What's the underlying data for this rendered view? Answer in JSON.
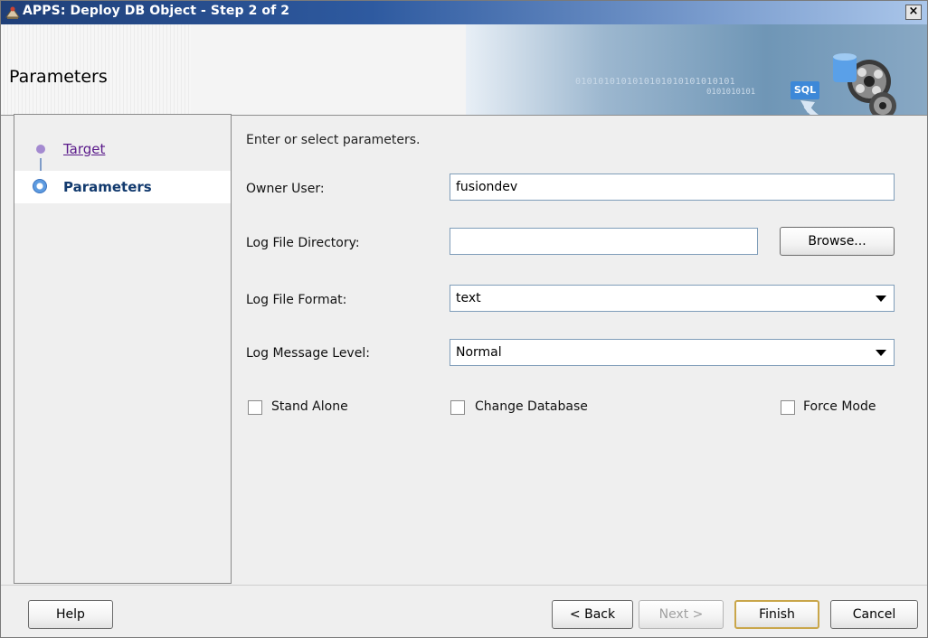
{
  "window": {
    "title": "APPS: Deploy DB Object - Step 2 of 2",
    "close_glyph": "×"
  },
  "banner": {
    "page_title": "Parameters",
    "binary_text_1": "0101010101010101010101010101",
    "binary_text_2": "0101010101",
    "sql_badge": "SQL"
  },
  "steps": [
    {
      "label": "Target",
      "state": "link"
    },
    {
      "label": "Parameters",
      "state": "current"
    }
  ],
  "form": {
    "intro": "Enter or select parameters.",
    "owner_user": {
      "label": "Owner User:",
      "value": "fusiondev"
    },
    "log_file_directory": {
      "label": "Log File Directory:",
      "value": "",
      "browse_label": "Browse..."
    },
    "log_file_format": {
      "label": "Log File Format:",
      "value": "text"
    },
    "log_message_level": {
      "label": "Log Message Level:",
      "value": "Normal"
    },
    "stand_alone": {
      "label": "Stand Alone",
      "checked": false
    },
    "change_database": {
      "label": "Change Database",
      "checked": false
    },
    "force_mode": {
      "label": "Force Mode",
      "checked": false
    }
  },
  "footer": {
    "help": "Help",
    "back": "< Back",
    "next": "Next >",
    "finish": "Finish",
    "cancel": "Cancel"
  },
  "colors": {
    "title_bar_start": "#1f3f78",
    "link": "#5a1a8a",
    "current_step": "#123a6e",
    "default_button_border": "#c9a64a"
  }
}
